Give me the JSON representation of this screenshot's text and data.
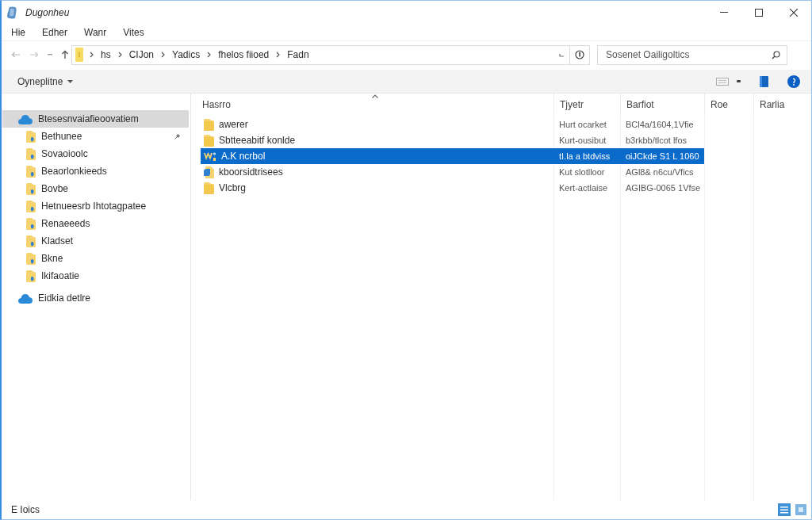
{
  "window": {
    "title": "Dugonheu"
  },
  "menu": [
    {
      "label": "Hie"
    },
    {
      "label": "Edher"
    },
    {
      "label": "Wanr"
    },
    {
      "label": "Vites"
    }
  ],
  "address_bar": {
    "path": [
      "hs",
      "CIJon",
      "Yadics",
      "fhelos fiioed",
      "Fadn"
    ]
  },
  "search": {
    "placeholder": "Sosenet Oailigoltics"
  },
  "command_bar": {
    "organize": "Oyneplitne"
  },
  "sidebar": {
    "items": [
      {
        "label": "Btesesnvaiafieoovatiem",
        "kind": "cloud",
        "selected": true,
        "children": [
          {
            "label": "Bethunee",
            "pinned": true,
            "selected": false
          },
          {
            "label": "Sovaoioolc",
            "pinned": false,
            "selected": false
          },
          {
            "label": "Beaorlonkieeds",
            "pinned": false,
            "selected": false
          },
          {
            "label": "Bovbe",
            "pinned": false,
            "selected": false
          },
          {
            "label": "Hetnueesrb Ihtotagpatee",
            "pinned": false,
            "selected": false
          },
          {
            "label": "Renaeeeds",
            "pinned": false,
            "selected": false
          },
          {
            "label": "Kladset",
            "pinned": false,
            "selected": false
          },
          {
            "label": "Bkne",
            "pinned": false,
            "selected": false
          },
          {
            "label": "Ikifaoatie",
            "pinned": false,
            "selected": false
          }
        ]
      },
      {
        "label": "Eidkia detlre",
        "kind": "cloud",
        "selected": false
      }
    ]
  },
  "table": {
    "columns": [
      {
        "label": "Hasrro",
        "sorted": true
      },
      {
        "label": "Tjyetr",
        "sorted": false
      },
      {
        "label": "Barfiot",
        "sorted": false
      },
      {
        "label": "Roe",
        "sorted": false
      },
      {
        "label": "Rarlia",
        "sorted": false
      }
    ],
    "rows": [
      {
        "kind": "folder",
        "selected": false,
        "cells": [
          "awerer",
          "Hurt ocarket",
          "BCl4a/1604,1Vfie"
        ]
      },
      {
        "kind": "folder",
        "selected": false,
        "cells": [
          "Sbtteeabitf konlde",
          "Kurt-ousibut",
          "b3rkbb/tlcot lfos"
        ]
      },
      {
        "kind": "image",
        "selected": true,
        "cells": [
          "A.K ncrbol",
          "tI.la a btdviss",
          "oiJCkde S1 L 1060"
        ]
      },
      {
        "kind": "script",
        "selected": false,
        "cells": [
          "kboorsidtrisees",
          "Kut slotlloor",
          "AGl8& n6cu/Vfics"
        ]
      },
      {
        "kind": "folder",
        "selected": false,
        "cells": [
          "Vlcbrg",
          "Kert-actlaise",
          "AGIBG-0065 1Vfse"
        ]
      }
    ]
  },
  "status_bar": {
    "text": "E Ioics"
  }
}
